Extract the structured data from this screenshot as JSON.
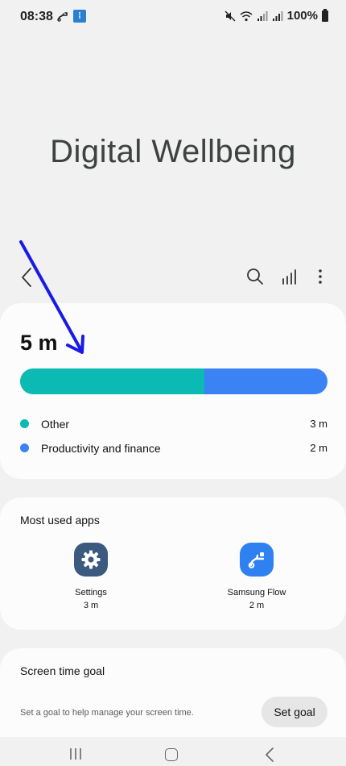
{
  "status_bar": {
    "time": "08:38",
    "battery": "100%",
    "icons": [
      "samsung-flow-icon",
      "samsung-internet-icon",
      "mute-icon",
      "wifi-icon",
      "signal-icon",
      "signal-icon",
      "battery-icon"
    ]
  },
  "app_title": "Digital Wellbeing",
  "toolbar": {
    "icons": [
      "back-icon",
      "search-icon",
      "bar-chart-icon",
      "more-icon"
    ]
  },
  "usage": {
    "total": "5 m",
    "categories": [
      {
        "name": "Other",
        "time": "3 m",
        "minutes": 3,
        "color": "#0bbab2"
      },
      {
        "name": "Productivity and finance",
        "time": "2 m",
        "minutes": 2,
        "color": "#3b83f5"
      }
    ]
  },
  "most_used": {
    "heading": "Most used apps",
    "apps": [
      {
        "name": "Settings",
        "time": "3 m",
        "icon": "settings-gear-icon",
        "color": "#3a5a80"
      },
      {
        "name": "Samsung Flow",
        "time": "2 m",
        "icon": "samsung-flow-icon",
        "color": "#2f80f0"
      }
    ]
  },
  "goal": {
    "heading": "Screen time goal",
    "description": "Set a goal to help manage your screen time.",
    "button": "Set goal"
  },
  "colors": {
    "background": "#f0f1f0",
    "card": "#fcfcfc",
    "annotation_arrow": "#1a1ae6"
  }
}
